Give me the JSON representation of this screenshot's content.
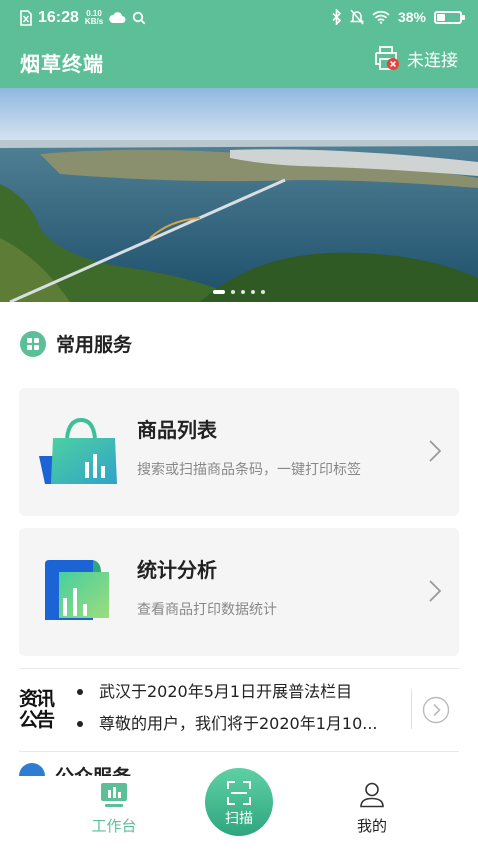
{
  "status_bar": {
    "time": "16:28",
    "net_speed_value": "0.10",
    "net_speed_unit": "KB/s",
    "battery": "38%",
    "battery_level": 0.38
  },
  "app_bar": {
    "title": "烟草终端",
    "printer_status": "未连接"
  },
  "banner": {
    "slide_count": 5,
    "active_slide": 1
  },
  "common_services": {
    "title": "常用服务",
    "cards": [
      {
        "title": "商品列表",
        "description": "搜索或扫描商品条码，一键打印标签",
        "icon": "shopping-bag-chart-icon"
      },
      {
        "title": "统计分析",
        "description": "查看商品打印数据统计",
        "icon": "statistics-chart-icon"
      }
    ]
  },
  "announcements": {
    "logo_line1": "资讯",
    "logo_line2": "公告",
    "items": [
      "武汉于2020年5月1日开展普法栏目",
      "尊敬的用户，我们将于2020年1月10..."
    ]
  },
  "public_services": {
    "title": "公众服务"
  },
  "tab_bar": {
    "workbench": "工作台",
    "scan": "扫描",
    "mine": "我的"
  },
  "colors": {
    "brand_green": "#5cbf98",
    "accent_blue": "#2f7dd3"
  }
}
